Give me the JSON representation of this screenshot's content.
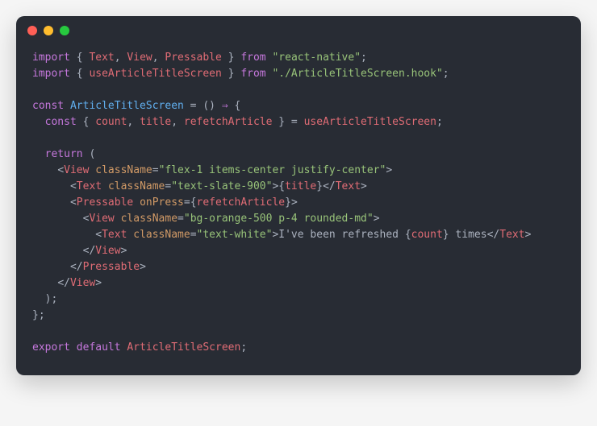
{
  "colors": {
    "bg": "#282c34",
    "red": "#ff5f56",
    "yellow": "#ffbd2e",
    "green": "#27c93f"
  },
  "code": {
    "lines": [
      [
        [
          "kw",
          "import"
        ],
        [
          "pn",
          " { "
        ],
        [
          "id",
          "Text"
        ],
        [
          "pn",
          ", "
        ],
        [
          "id",
          "View"
        ],
        [
          "pn",
          ", "
        ],
        [
          "id",
          "Pressable"
        ],
        [
          "pn",
          " } "
        ],
        [
          "kw",
          "from"
        ],
        [
          "pn",
          " "
        ],
        [
          "str",
          "\"react-native\""
        ],
        [
          "pn",
          ";"
        ]
      ],
      [
        [
          "kw",
          "import"
        ],
        [
          "pn",
          " { "
        ],
        [
          "id",
          "useArticleTitleScreen"
        ],
        [
          "pn",
          " } "
        ],
        [
          "kw",
          "from"
        ],
        [
          "pn",
          " "
        ],
        [
          "str",
          "\"./ArticleTitleScreen.hook\""
        ],
        [
          "pn",
          ";"
        ]
      ],
      [],
      [
        [
          "kw",
          "const"
        ],
        [
          "pn",
          " "
        ],
        [
          "fn",
          "ArticleTitleScreen"
        ],
        [
          "pn",
          " = () "
        ],
        [
          "kw",
          "⇒"
        ],
        [
          "pn",
          " {"
        ]
      ],
      [
        [
          "pn",
          "  "
        ],
        [
          "kw",
          "const"
        ],
        [
          "pn",
          " { "
        ],
        [
          "id",
          "count"
        ],
        [
          "pn",
          ", "
        ],
        [
          "id",
          "title"
        ],
        [
          "pn",
          ", "
        ],
        [
          "id",
          "refetchArticle"
        ],
        [
          "pn",
          " } = "
        ],
        [
          "id",
          "useArticleTitleScreen"
        ],
        [
          "pn",
          ";"
        ]
      ],
      [],
      [
        [
          "pn",
          "  "
        ],
        [
          "kw",
          "return"
        ],
        [
          "pn",
          " ("
        ]
      ],
      [
        [
          "pn",
          "    "
        ],
        [
          "tagp",
          "<"
        ],
        [
          "tag",
          "View"
        ],
        [
          "pn",
          " "
        ],
        [
          "attr",
          "className"
        ],
        [
          "pn",
          "="
        ],
        [
          "str",
          "\"flex-1 items-center justify-center\""
        ],
        [
          "tagp",
          ">"
        ]
      ],
      [
        [
          "pn",
          "      "
        ],
        [
          "tagp",
          "<"
        ],
        [
          "tag",
          "Text"
        ],
        [
          "pn",
          " "
        ],
        [
          "attr",
          "className"
        ],
        [
          "pn",
          "="
        ],
        [
          "str",
          "\"text-slate-900\""
        ],
        [
          "tagp",
          ">"
        ],
        [
          "pn",
          "{"
        ],
        [
          "sub",
          "title"
        ],
        [
          "pn",
          "}"
        ],
        [
          "tagp",
          "</"
        ],
        [
          "tag",
          "Text"
        ],
        [
          "tagp",
          ">"
        ]
      ],
      [
        [
          "pn",
          "      "
        ],
        [
          "tagp",
          "<"
        ],
        [
          "tag",
          "Pressable"
        ],
        [
          "pn",
          " "
        ],
        [
          "attr",
          "onPress"
        ],
        [
          "pn",
          "={"
        ],
        [
          "sub",
          "refetchArticle"
        ],
        [
          "pn",
          "}"
        ],
        [
          "tagp",
          ">"
        ]
      ],
      [
        [
          "pn",
          "        "
        ],
        [
          "tagp",
          "<"
        ],
        [
          "tag",
          "View"
        ],
        [
          "pn",
          " "
        ],
        [
          "attr",
          "className"
        ],
        [
          "pn",
          "="
        ],
        [
          "str",
          "\"bg-orange-500 p-4 rounded-md\""
        ],
        [
          "tagp",
          ">"
        ]
      ],
      [
        [
          "pn",
          "          "
        ],
        [
          "tagp",
          "<"
        ],
        [
          "tag",
          "Text"
        ],
        [
          "pn",
          " "
        ],
        [
          "attr",
          "className"
        ],
        [
          "pn",
          "="
        ],
        [
          "str",
          "\"text-white\""
        ],
        [
          "tagp",
          ">"
        ],
        [
          "txt",
          "I've been refreshed "
        ],
        [
          "pn",
          "{"
        ],
        [
          "sub",
          "count"
        ],
        [
          "pn",
          "}"
        ],
        [
          "txt",
          " times"
        ],
        [
          "tagp",
          "</"
        ],
        [
          "tag",
          "Text"
        ],
        [
          "tagp",
          ">"
        ]
      ],
      [
        [
          "pn",
          "        "
        ],
        [
          "tagp",
          "</"
        ],
        [
          "tag",
          "View"
        ],
        [
          "tagp",
          ">"
        ]
      ],
      [
        [
          "pn",
          "      "
        ],
        [
          "tagp",
          "</"
        ],
        [
          "tag",
          "Pressable"
        ],
        [
          "tagp",
          ">"
        ]
      ],
      [
        [
          "pn",
          "    "
        ],
        [
          "tagp",
          "</"
        ],
        [
          "tag",
          "View"
        ],
        [
          "tagp",
          ">"
        ]
      ],
      [
        [
          "pn",
          "  );"
        ]
      ],
      [
        [
          "pn",
          "};"
        ]
      ],
      [],
      [
        [
          "kw",
          "export"
        ],
        [
          "pn",
          " "
        ],
        [
          "kw",
          "default"
        ],
        [
          "pn",
          " "
        ],
        [
          "id",
          "ArticleTitleScreen"
        ],
        [
          "pn",
          ";"
        ]
      ]
    ]
  }
}
